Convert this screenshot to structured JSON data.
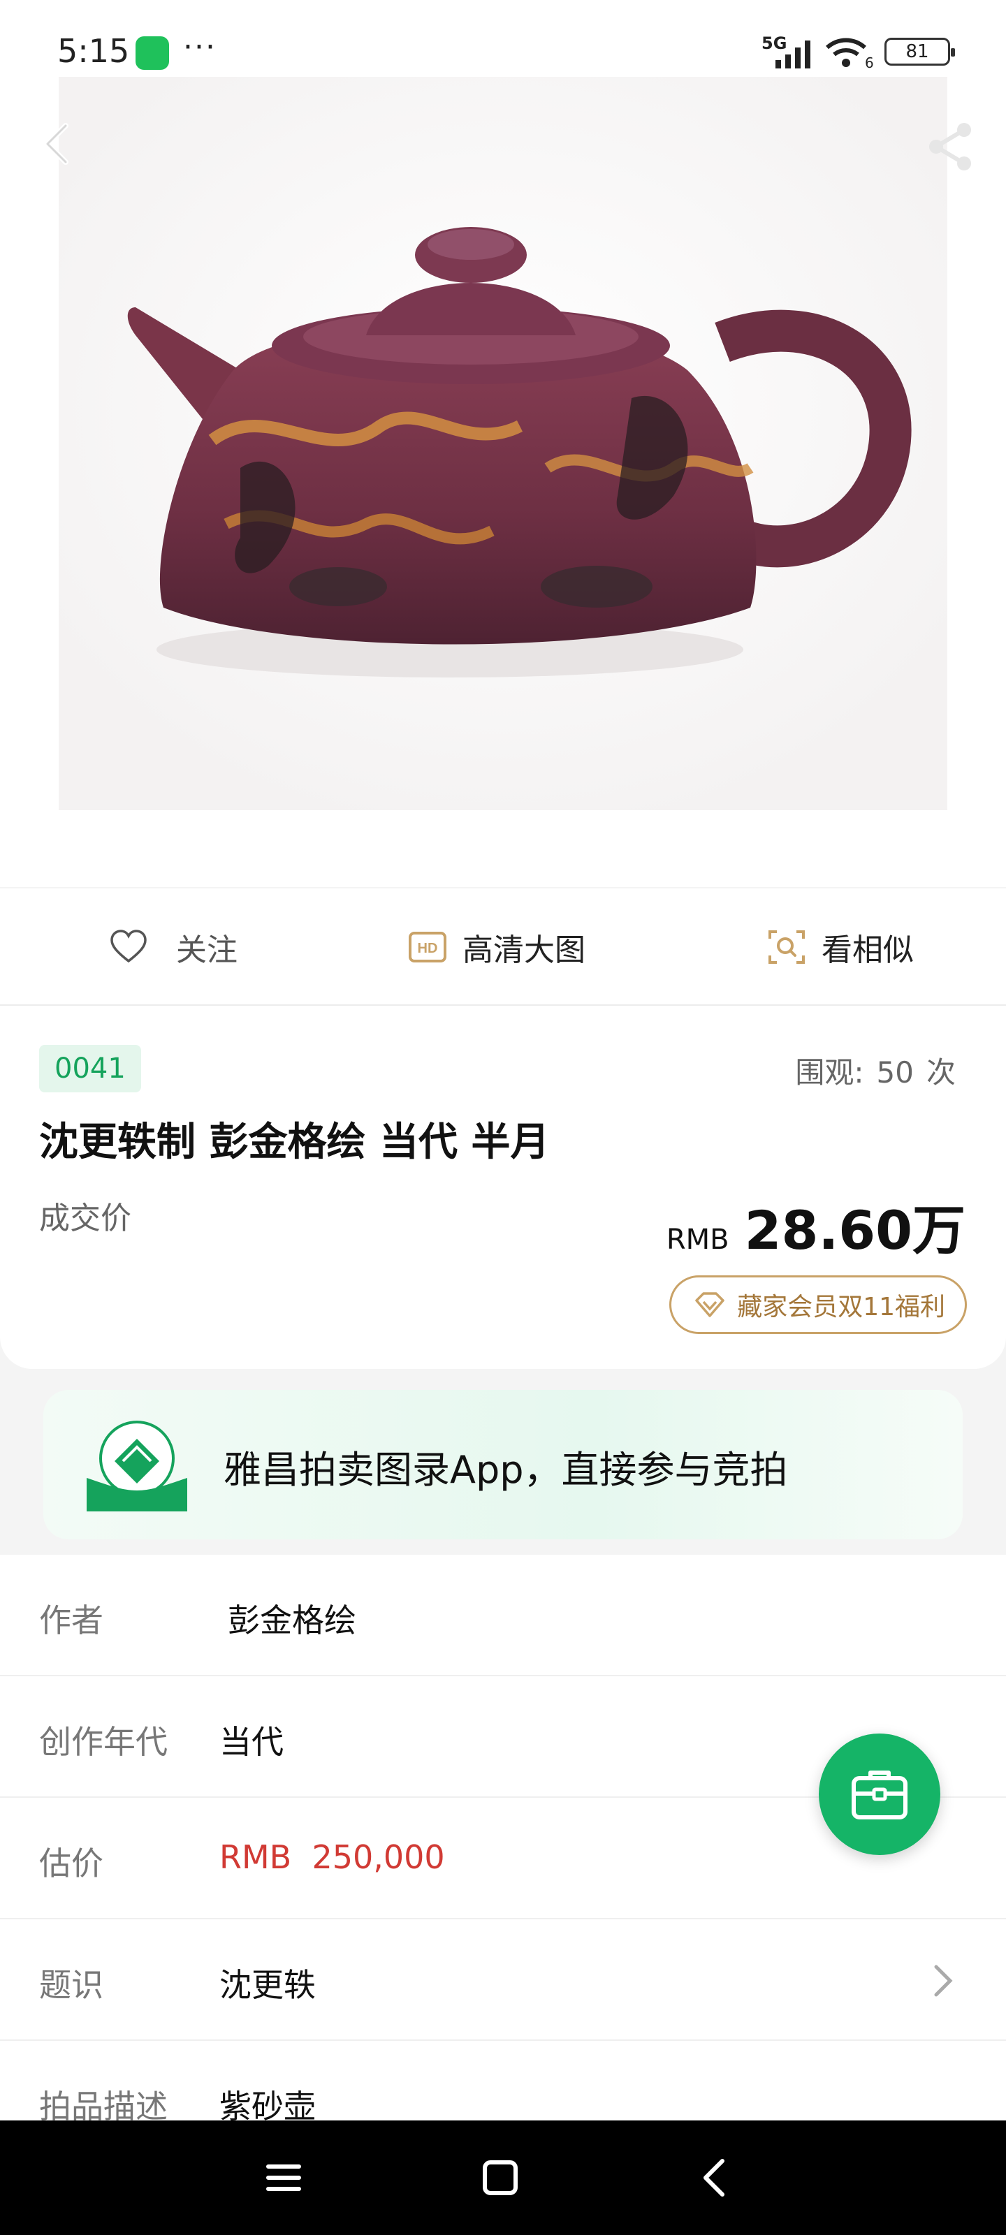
{
  "status_bar": {
    "time": "5:15",
    "more": "···",
    "network": "5G",
    "wifi_badge": "6",
    "battery": "81",
    "icons": [
      "wechat-icon",
      "signal-icon",
      "wifi-icon",
      "battery-icon"
    ]
  },
  "hero": {
    "icons": [
      "back-arrow-icon",
      "share-icon"
    ],
    "image_subject": "zisha teapot"
  },
  "actions": {
    "follow": "关注",
    "hd": "高清大图",
    "similar": "看相似",
    "icons": [
      "heart-icon",
      "hd-icon",
      "search-similar-icon"
    ]
  },
  "lot": {
    "number": "0041",
    "views_label": "围观:",
    "views_count": "50",
    "views_unit": "次",
    "title": "沈更轶制 彭金格绘 当代 半月",
    "deal_label": "成交价",
    "currency": "RMB",
    "price": "28.60万",
    "member_promo": "藏家会员双11福利"
  },
  "banner": {
    "text": "雅昌拍卖图录App，直接参与竞拍",
    "brand_color": "#15a35c"
  },
  "details": {
    "rows": [
      {
        "key": "作者",
        "value": "彭金格绘"
      },
      {
        "key": "创作年代",
        "value": "当代"
      },
      {
        "key": "估价",
        "value": "RMB  250,000"
      },
      {
        "key": "题识",
        "value": "沈更轶"
      },
      {
        "key": "拍品描述",
        "value": "紫砂壶"
      }
    ]
  },
  "colors": {
    "accent_green": "#15b467",
    "estimate_red": "#d13a34",
    "gold": "#a4773a"
  },
  "nav": {
    "icons": [
      "menu-icon",
      "home-icon",
      "back-icon"
    ]
  }
}
